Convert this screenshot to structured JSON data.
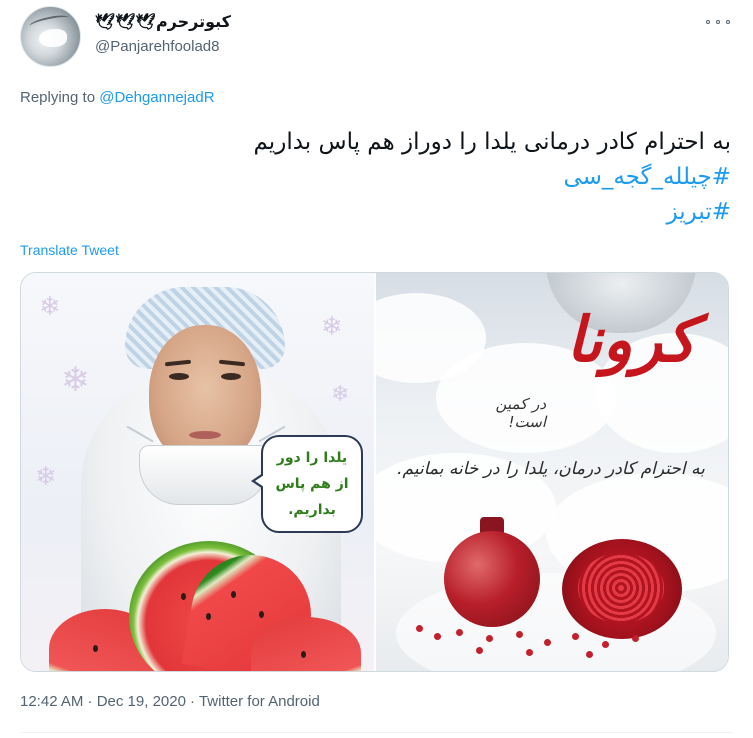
{
  "tweet": {
    "display_name": "کبوترحرم🕊🕊🕊",
    "username": "@Panjarehfoolad8",
    "replying_to_prefix": "Replying to",
    "replying_to_handle": "@DehgannejadR",
    "text": "به احترام کادر درمانی یلدا را دوراز هم پاس بداریم",
    "hashtags": [
      "#چیلله_گجه_سی",
      "#تبریز"
    ],
    "translate_label": "Translate Tweet",
    "timestamp": "12:42 AM · Dec 19, 2020",
    "source": "Twitter for Android"
  },
  "media": {
    "left_image": {
      "bubble_lines": [
        "یلدا را دور",
        "از هم پاس",
        "بداریم."
      ]
    },
    "right_image": {
      "headline": "کرونا",
      "headline_suffix": "در کمین است!",
      "caption": "به احترام کادر درمان، یلدا را در خانه بمانیم."
    }
  },
  "colors": {
    "link": "#1d9bf0",
    "text": "#0f1419",
    "secondary": "#536471",
    "corona_red": "#c4161c",
    "bubble_green": "#2e7d1a"
  },
  "icons": {
    "more": "more-horizontal-icon"
  }
}
